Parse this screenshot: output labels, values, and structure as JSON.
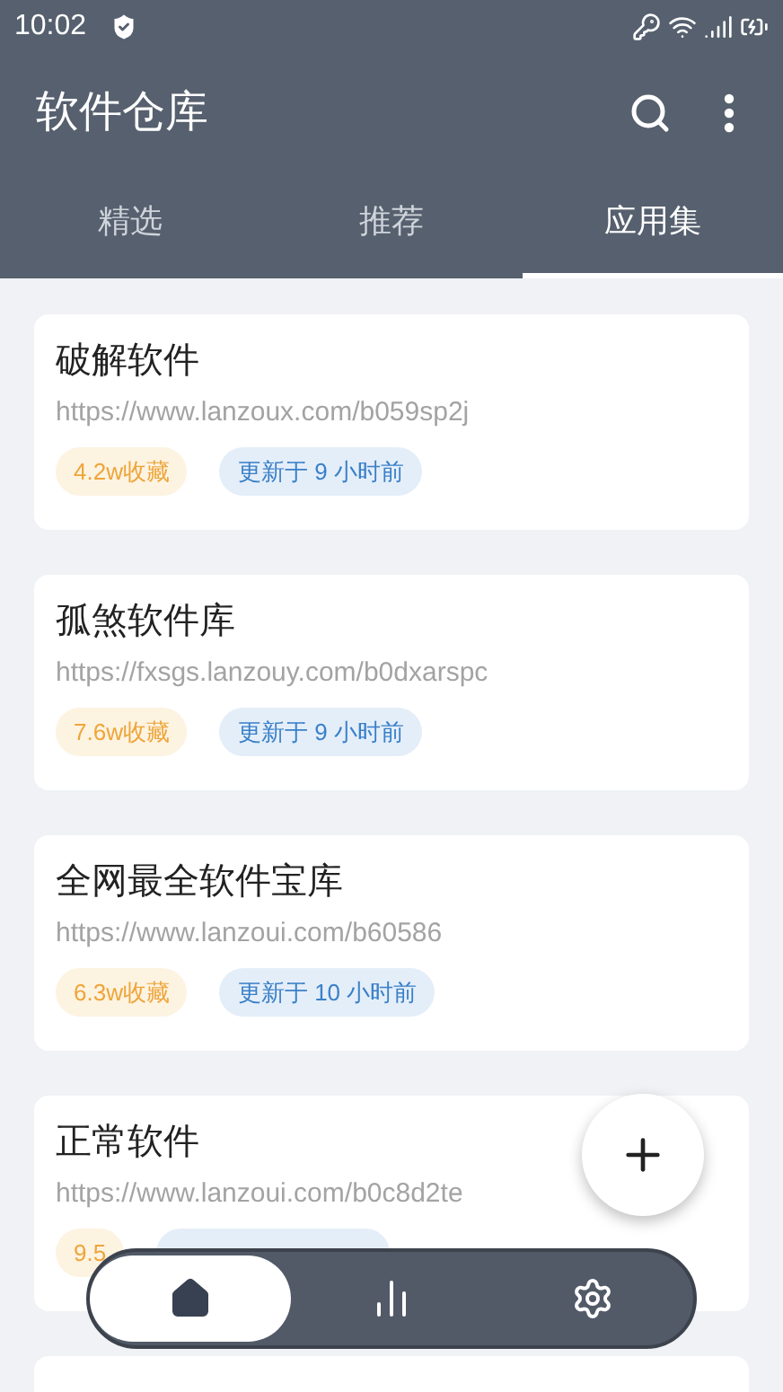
{
  "status_bar": {
    "time": "10:02"
  },
  "app_bar": {
    "title": "软件仓库"
  },
  "tabs": [
    {
      "label": "精选",
      "selected": false
    },
    {
      "label": "推荐",
      "selected": false
    },
    {
      "label": "应用集",
      "selected": true
    }
  ],
  "collections": [
    {
      "title": "破解软件",
      "url": "https://www.lanzoux.com/b059sp2j",
      "favorites": "4.2w收藏",
      "updated": "更新于 9 小时前"
    },
    {
      "title": "孤煞软件库",
      "url": "https://fxsgs.lanzouy.com/b0dxarspc",
      "favorites": "7.6w收藏",
      "updated": "更新于 9 小时前"
    },
    {
      "title": "全网最全软件宝库",
      "url": "https://www.lanzoui.com/b60586",
      "favorites": "6.3w收藏",
      "updated": "更新于 10 小时前"
    },
    {
      "title": "正常软件",
      "url": "https://www.lanzoui.com/b0c8d2te",
      "favorites": "9.5"
    }
  ],
  "bottom_nav": [
    {
      "kind": "home",
      "selected": true
    },
    {
      "kind": "chart",
      "selected": false
    },
    {
      "kind": "settings",
      "selected": false
    }
  ]
}
